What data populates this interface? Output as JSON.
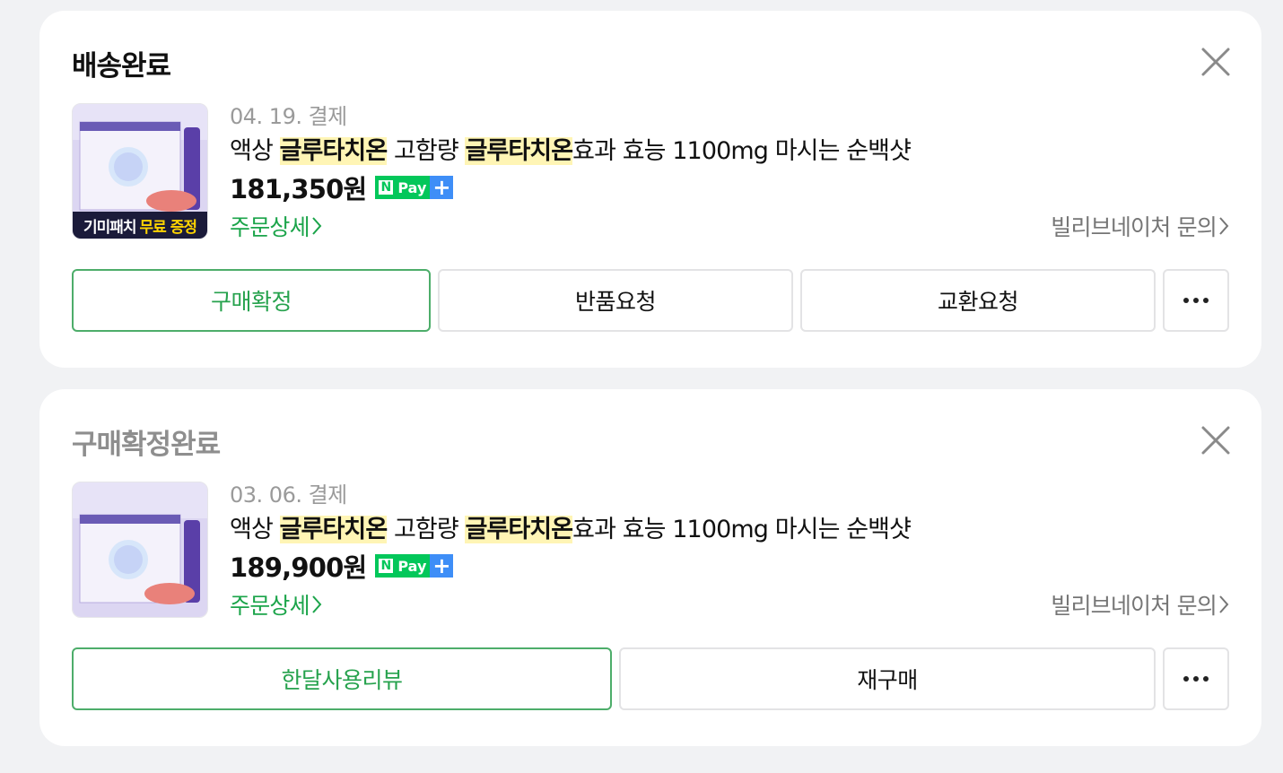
{
  "orders": [
    {
      "status": "배송완료",
      "date": "04. 19. 결제",
      "title_parts": [
        "액상 ",
        "글루타치온",
        " 고함량 ",
        "글루타치온",
        "효과 효능 1100mg 마시는 순백샷"
      ],
      "price": "181,350원",
      "npay": {
        "label": "Pay",
        "n": "N",
        "plus": "+"
      },
      "detail_link": "주문상세",
      "inquiry_link": "빌리브네이처 문의",
      "thumb_banner_text_1": "기미패치",
      "thumb_banner_text_2": "무료 증정",
      "buttons": [
        "구매확정",
        "반품요청",
        "교환요청"
      ]
    },
    {
      "status": "구매확정완료",
      "date": "03. 06. 결제",
      "title_parts": [
        "액상 ",
        "글루타치온",
        " 고함량 ",
        "글루타치온",
        "효과 효능 1100mg 마시는 순백샷"
      ],
      "price": "189,900원",
      "npay": {
        "label": "Pay",
        "n": "N",
        "plus": "+"
      },
      "detail_link": "주문상세",
      "inquiry_link": "빌리브네이처 문의",
      "buttons": [
        "한달사용리뷰",
        "재구매"
      ]
    }
  ],
  "colors": {
    "accent_green": "#26a24d",
    "highlight": "#fff5b5",
    "npay_green": "#03c75a",
    "npay_blue": "#3e8ef7"
  },
  "icons": [
    "close-icon",
    "chevron-right-icon",
    "more-icon"
  ]
}
